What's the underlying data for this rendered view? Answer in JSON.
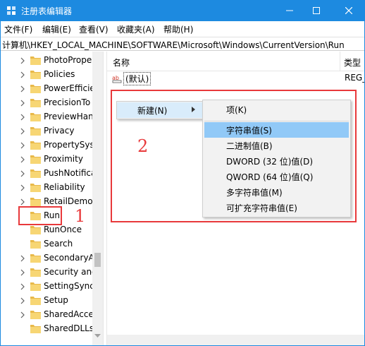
{
  "window": {
    "title": "注册表编辑器",
    "accent": "#1d8ae0"
  },
  "menubar": {
    "items": [
      "文件(F)",
      "编辑(E)",
      "查看(V)",
      "收藏夹(A)",
      "帮助(H)"
    ]
  },
  "address": {
    "path": "计算机\\HKEY_LOCAL_MACHINE\\SOFTWARE\\Microsoft\\Windows\\CurrentVersion\\Run"
  },
  "tree": {
    "items": [
      {
        "label": "PhotoPrope",
        "expandable": true
      },
      {
        "label": "Policies",
        "expandable": true
      },
      {
        "label": "PowerEfficie",
        "expandable": true
      },
      {
        "label": "PrecisionTo",
        "expandable": true
      },
      {
        "label": "PreviewHan",
        "expandable": true
      },
      {
        "label": "Privacy",
        "expandable": true
      },
      {
        "label": "PropertySys",
        "expandable": true
      },
      {
        "label": "Proximity",
        "expandable": true
      },
      {
        "label": "PushNotifica",
        "expandable": true
      },
      {
        "label": "Reliability",
        "expandable": true
      },
      {
        "label": "RetailDemo",
        "expandable": true
      },
      {
        "label": "Run",
        "expandable": false,
        "selected": true
      },
      {
        "label": "RunOnce",
        "expandable": false
      },
      {
        "label": "Search",
        "expandable": false
      },
      {
        "label": "SecondaryA",
        "expandable": true
      },
      {
        "label": "Security and",
        "expandable": true
      },
      {
        "label": "SettingSync",
        "expandable": true
      },
      {
        "label": "Setup",
        "expandable": true
      },
      {
        "label": "SharedAcce",
        "expandable": true
      },
      {
        "label": "SharedDLLs",
        "expandable": false
      }
    ]
  },
  "list": {
    "columns": {
      "name": "名称",
      "type": "类型"
    },
    "rows": [
      {
        "icon": "string-value-icon",
        "name": "(默认)",
        "type": "REG_"
      }
    ]
  },
  "context_menu": {
    "new_label": "新建(N)",
    "submenu": [
      {
        "label": "项(K)"
      },
      {
        "label": "字符串值(S)",
        "highlighted": true
      },
      {
        "label": "二进制值(B)"
      },
      {
        "label": "DWORD (32 位)值(D)"
      },
      {
        "label": "QWORD (64 位)值(Q)"
      },
      {
        "label": "多字符串值(M)"
      },
      {
        "label": "可扩充字符串值(E)"
      }
    ]
  },
  "annotations": {
    "step1": "1",
    "step2": "2",
    "color": "#e8393b"
  }
}
